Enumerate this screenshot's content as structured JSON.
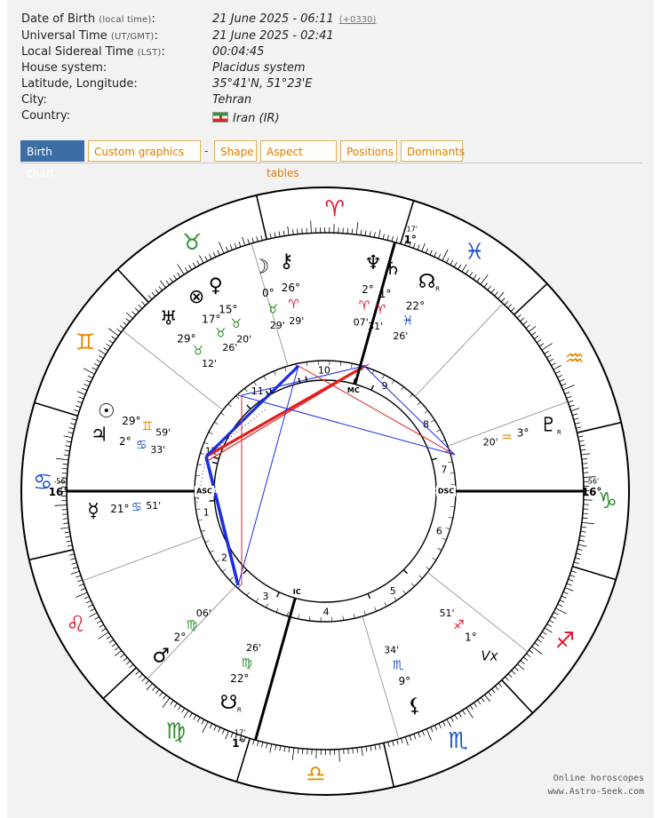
{
  "info": {
    "dob_label": "Date of Birth",
    "dob_note": "(local time)",
    "dob_value": "21 June 2025 - 06:11",
    "tz_link": "(+0330)",
    "ut_label": "Universal Time",
    "ut_note": "(UT/GMT)",
    "ut_value": "21 June 2025 - 02:41",
    "lst_label": "Local Sidereal Time",
    "lst_note": "(LST)",
    "lst_value": "00:04:45",
    "house_label": "House system:",
    "house_value": "Placidus system",
    "latlon_label": "Latitude, Longitude:",
    "latlon_value": "35°41'N, 51°23'E",
    "city_label": "City:",
    "city_value": "Tehran",
    "country_label": "Country:",
    "country_value": "Iran (IR)"
  },
  "tabs": [
    {
      "label": "Birth chart",
      "active": true
    },
    {
      "label": "Custom graphics"
    },
    {
      "label": "Shape"
    },
    {
      "label": "Aspect tables"
    },
    {
      "label": "Positions"
    },
    {
      "label": "Dominants"
    }
  ],
  "tab_separator": "-",
  "colors": {
    "accent_blue": "#3a6ea5",
    "tab_orange": "#e07b00",
    "fire_red": "#e0102a",
    "earth_green": "#2f8f2f",
    "air_orange": "#e08a00",
    "water_blue": "#1a50c8",
    "aspect_red": "#e02020",
    "aspect_blue": "#1b2ee0"
  },
  "wheel": {
    "signs": [
      {
        "glyph": "♈",
        "name": "aries",
        "color": "#e0102a"
      },
      {
        "glyph": "♉",
        "name": "taurus",
        "color": "#2f8f2f"
      },
      {
        "glyph": "♊",
        "name": "gemini",
        "color": "#e08a00"
      },
      {
        "glyph": "♋",
        "name": "cancer",
        "color": "#1a50c8"
      },
      {
        "glyph": "♌",
        "name": "leo",
        "color": "#e0102a"
      },
      {
        "glyph": "♍",
        "name": "virgo",
        "color": "#2f8f2f"
      },
      {
        "glyph": "♎",
        "name": "libra",
        "color": "#e08a00"
      },
      {
        "glyph": "♏",
        "name": "scorpio",
        "color": "#1a50c8"
      },
      {
        "glyph": "♐",
        "name": "sagittarius",
        "color": "#e0102a"
      },
      {
        "glyph": "♑",
        "name": "capricorn",
        "color": "#2f8f2f"
      },
      {
        "glyph": "♒",
        "name": "aquarius",
        "color": "#e08a00"
      },
      {
        "glyph": "♓",
        "name": "pisces",
        "color": "#1a50c8"
      }
    ],
    "asc_longitude": 106.93,
    "axes": {
      "asc_label": "ASC",
      "dsc_label": "DSC",
      "mc_label": "MC",
      "ic_label": "IC",
      "asc_deg": "16°",
      "asc_min": "-56'",
      "dsc_deg": "16°",
      "dsc_min": "56'",
      "mc_deg": "1°",
      "mc_min": "17'",
      "ic_deg": "1°",
      "ic_min": "17'"
    },
    "house_cusps": [
      106.93,
      127.2,
      153.5,
      181.28,
      213.5,
      248.5,
      286.93,
      307.2,
      333.5,
      1.28,
      33.5,
      68.5
    ],
    "house_numbers": [
      "1",
      "2",
      "3",
      "4",
      "5",
      "6",
      "7",
      "8",
      "9",
      "10",
      "11",
      "12"
    ],
    "planets": [
      {
        "name": "moon",
        "glyph": "☽",
        "lon": 30.1,
        "deg": "0°",
        "sign": "♉",
        "min": "29'"
      },
      {
        "name": "chiron",
        "glyph": "⚷",
        "lon": 26.48,
        "deg": "26°",
        "sign": "♈",
        "min": "29'"
      },
      {
        "name": "neptune",
        "glyph": "♆",
        "lon": 2.12,
        "deg": "2°",
        "sign": "♈",
        "min": "07'"
      },
      {
        "name": "saturn",
        "glyph": "♄",
        "lon": 1.52,
        "deg": "1°",
        "sign": "♈",
        "min": "31'"
      },
      {
        "name": "north-node",
        "glyph": "☊",
        "lon": 352.43,
        "deg": "22°",
        "sign": "♓",
        "min": "26'",
        "retro": "R"
      },
      {
        "name": "venus",
        "glyph": "♀",
        "lon": 45.33,
        "deg": "15°",
        "sign": "♉",
        "min": "20'"
      },
      {
        "name": "part-of-fortune",
        "glyph": "⊗",
        "lon": 47.43,
        "deg": "17°",
        "sign": "♉",
        "min": "26'"
      },
      {
        "name": "uranus",
        "glyph": "♅",
        "lon": 59.2,
        "deg": "29°",
        "sign": "♉",
        "min": "12'"
      },
      {
        "name": "sun",
        "glyph": "☉",
        "lon": 89.98,
        "deg": "29°",
        "sign": "♊",
        "min": "59'"
      },
      {
        "name": "jupiter",
        "glyph": "♃",
        "lon": 92.55,
        "deg": "2°",
        "sign": "♋",
        "min": "33'"
      },
      {
        "name": "mercury",
        "glyph": "☿",
        "lon": 111.85,
        "deg": "21°",
        "sign": "♋",
        "min": "51'"
      },
      {
        "name": "mars",
        "glyph": "♂",
        "lon": 152.1,
        "deg": "2°",
        "sign": "♍",
        "min": "06'"
      },
      {
        "name": "south-node",
        "glyph": "☋",
        "lon": 172.43,
        "deg": "22°",
        "sign": "♍",
        "min": "26'",
        "retro": "R"
      },
      {
        "name": "lilith",
        "glyph": "⚸",
        "lon": 219.57,
        "deg": "9°",
        "sign": "♏",
        "min": "34'"
      },
      {
        "name": "vertex",
        "glyph": "Vx",
        "lon": 241.85,
        "deg": "1°",
        "sign": "♐",
        "min": "51'"
      },
      {
        "name": "pluto",
        "glyph": "♇",
        "lon": 303.33,
        "deg": "3°",
        "sign": "♒",
        "min": "20'",
        "retro": "R"
      }
    ]
  },
  "footer": {
    "line1": "Online horoscopes",
    "line2": "www.Astro-Seek.com"
  }
}
